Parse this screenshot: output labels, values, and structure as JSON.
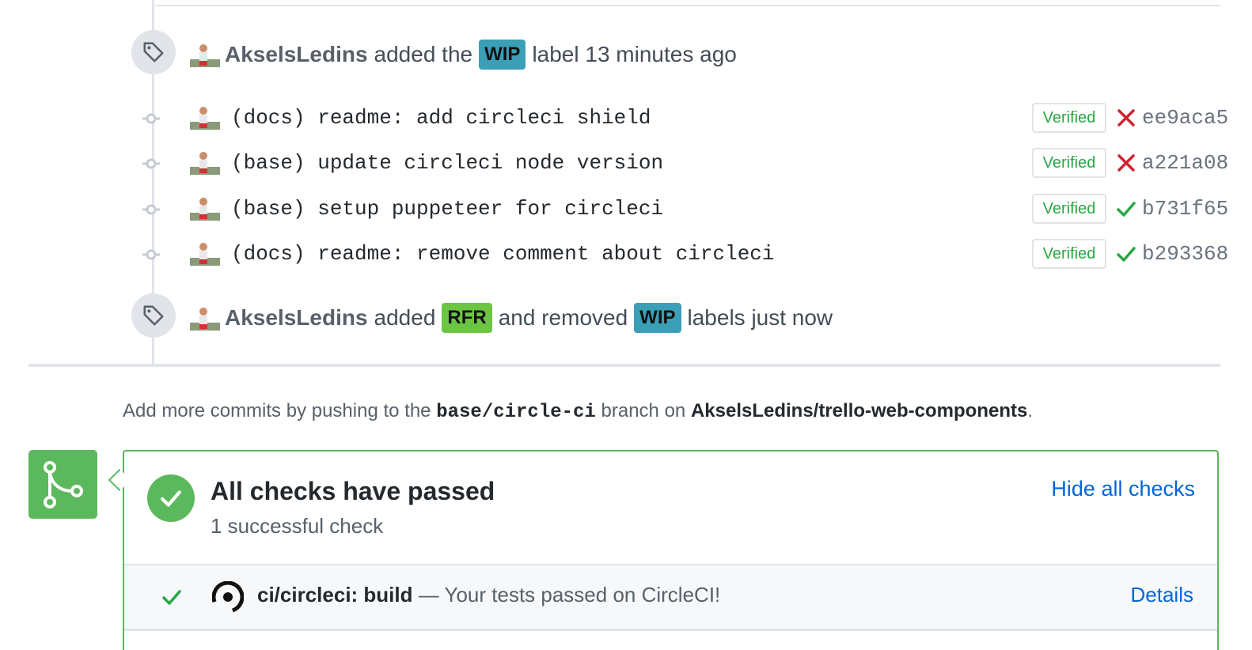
{
  "timeline": {
    "event_labeled": {
      "author": "AkselsLedins",
      "text_before": "added the",
      "label": {
        "name": "WIP",
        "color": "#3a9fb7"
      },
      "text_after": "label 13 minutes ago",
      "icon": "tag-icon"
    },
    "commits": [
      {
        "message": "(docs) readme: add circleci shield",
        "verified": "Verified",
        "status": "failed",
        "sha": "ee9aca5"
      },
      {
        "message": "(base) update circleci node version",
        "verified": "Verified",
        "status": "failed",
        "sha": "a221a08"
      },
      {
        "message": "(base) setup puppeteer for circleci",
        "verified": "Verified",
        "status": "success",
        "sha": "b731f65"
      },
      {
        "message": "(docs) readme: remove comment about circleci",
        "verified": "Verified",
        "status": "success",
        "sha": "b293368"
      }
    ],
    "event_relabeled": {
      "author": "AkselsLedins",
      "text_added": "added",
      "added_label": {
        "name": "RFR",
        "color": "#6cc644"
      },
      "text_removed": "and removed",
      "removed_label": {
        "name": "WIP",
        "color": "#3a9fb7"
      },
      "text_after": "labels just now",
      "icon": "tag-icon"
    }
  },
  "push_hint": {
    "prefix": "Add more commits by pushing to the",
    "branch": "base/circle-ci",
    "middle": "branch on",
    "repo": "AkselsLedins/trello-web-components",
    "suffix": "."
  },
  "checks": {
    "title": "All checks have passed",
    "subtitle": "1 successful check",
    "toggle_label": "Hide all checks",
    "items": [
      {
        "name": "ci/circleci: build",
        "description": "— Your tests passed on CircleCI!",
        "link_label": "Details",
        "icon": "circleci-logo-icon"
      }
    ]
  },
  "colors": {
    "success": "#28a745",
    "failure": "#cb2431",
    "merge_green": "#5cb85c",
    "link": "#0366d6"
  }
}
